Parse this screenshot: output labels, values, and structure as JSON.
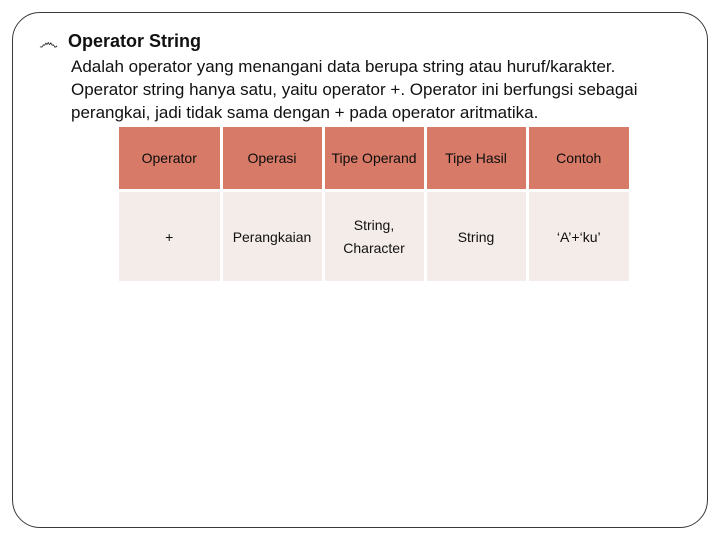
{
  "bullet_glyph": "෴",
  "heading": "Operator String",
  "description": "Adalah operator yang menangani data berupa string atau huruf/karakter. Operator string hanya satu, yaitu operator +. Operator ini berfungsi sebagai perangkai, jadi tidak sama dengan + pada operator aritmatika.",
  "table": {
    "headers": {
      "c0": "Operator",
      "c1": "Operasi",
      "c2": "Tipe Operand",
      "c3": "Tipe Hasil",
      "c4": "Contoh"
    },
    "row": {
      "operator": "+",
      "operasi": "Perangkaian",
      "tipe_operand_line1": "String,",
      "tipe_operand_line2": "Character",
      "tipe_hasil": "String",
      "contoh": "‘A’+‘ku’"
    }
  },
  "chart_data": {
    "type": "table",
    "title": "Operator String",
    "columns": [
      "Operator",
      "Operasi",
      "Tipe Operand",
      "Tipe Hasil",
      "Contoh"
    ],
    "rows": [
      {
        "Operator": "+",
        "Operasi": "Perangkaian",
        "Tipe Operand": "String, Character",
        "Tipe Hasil": "String",
        "Contoh": "'A'+'ku'"
      }
    ]
  }
}
